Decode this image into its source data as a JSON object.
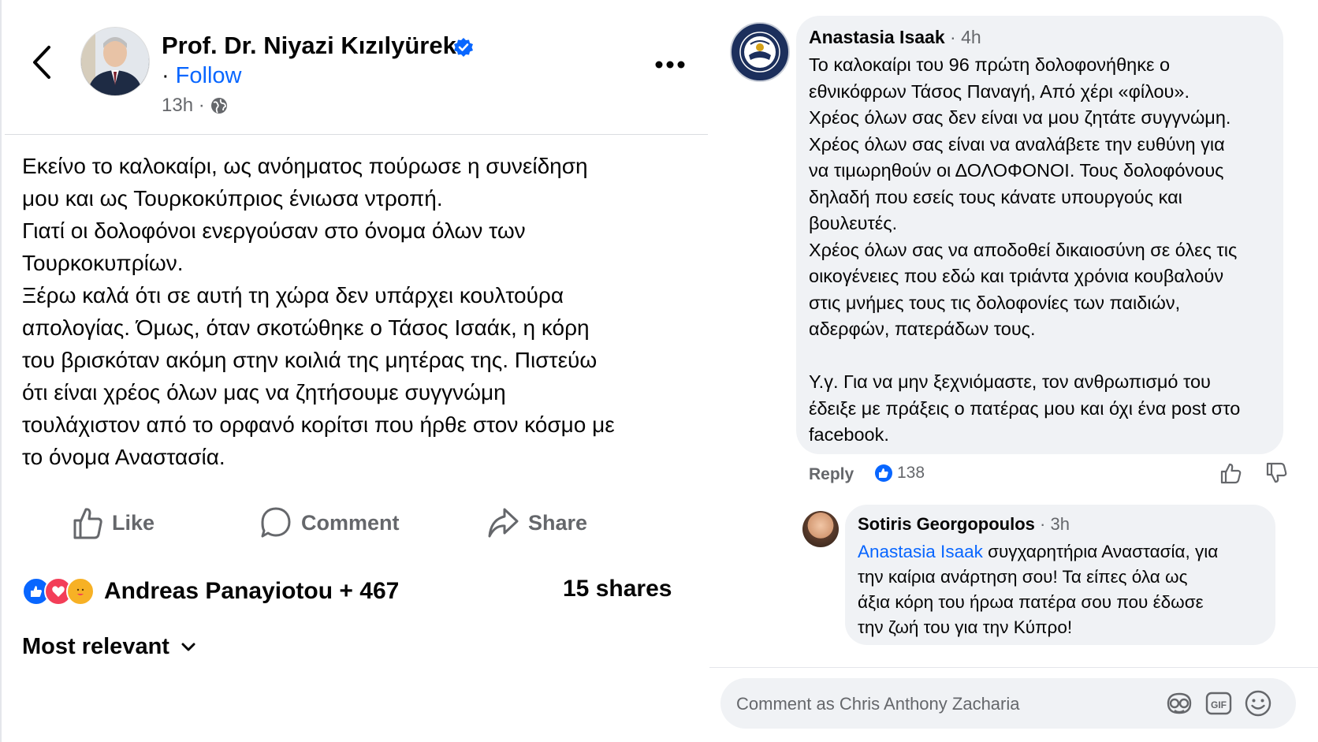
{
  "post": {
    "author": "Prof. Dr. Niyazi Kızılyürek",
    "follow_dot": "·",
    "follow_label": "Follow",
    "time": "13h ·",
    "body": [
      "Εκείνο το καλοκαίρι, ως ανόηματος πούρωσε η συνείδηση",
      "μου και ως Τουρκοκύπριος ένιωσα ντροπή.",
      "Γιατί οι δολοφόνοι ενεργούσαν στο όνομα όλων των",
      "Τουρκοκυπρίων.",
      "Ξέρω καλά ότι σε αυτή τη χώρα δεν υπάρχει κουλτούρα",
      "απολογίας. Όμως, όταν σκοτώθηκε ο Τάσος Ισαάκ, η κόρη",
      "του βρισκόταν ακόμη στην κοιλιά της μητέρας της. Πιστεύω",
      "ότι είναι χρέος όλων μας να ζητήσουμε συγγνώμη",
      "τουλάχιστον από το ορφανό κορίτσι που ήρθε στον κόσμο με",
      "το όνομα Αναστασία."
    ],
    "actions": {
      "like": "Like",
      "comment": "Comment",
      "share": "Share"
    },
    "reactions_text": "Andreas Panayiotou + 467",
    "shares_text": "15 shares",
    "sort_label": "Most relevant"
  },
  "comments": [
    {
      "author": "Anastasia Isaak",
      "time": "· 4h",
      "text": [
        "Το καλοκαίρι του 96 πρώτη δολοφονήθηκε ο",
        "εθνικόφρων Τάσος Παναγή, Από χέρι «φίλου».",
        "Χρέος όλων σας δεν είναι να μου ζητάτε συγγνώμη.",
        "Χρέος όλων σας είναι να αναλάβετε την ευθύνη για",
        "να τιμωρηθούν οι ΔΟΛΟΦΟΝΟΙ. Τους δολοφόνους",
        "δηλαδή που εσείς τους κάνατε υπουργούς και",
        "βουλευτές.",
        "Χρέος όλων σας να αποδοθεί δικαιοσύνη σε όλες τις",
        "οικογένειες που εδώ και τριάντα χρόνια κουβαλούν",
        "στις μνήμες τους τις δολοφονίες των παιδιών,",
        "αδερφών, πατεράδων τους.",
        "",
        "Υ.γ. Για να μην ξεχνιόμαστε, τον ανθρωπισμό του",
        "έδειξε με πράξεις ο πατέρας μου και όχι ένα post στο",
        "facebook."
      ],
      "reply_label": "Reply",
      "like_count": "138"
    },
    {
      "author": "Sotiris Georgopoulos",
      "time": "· 3h",
      "mention": "Anastasia Isaak",
      "text_first": " συγχαρητήρια Αναστασία, για",
      "text_rest": [
        "την καίρια ανάρτηση σου! Τα είπες όλα ως",
        "άξια κόρη του ήρωα πατέρα σου που έδωσε",
        "την ζωή του για την Κύπρο!"
      ]
    }
  ],
  "composer": {
    "placeholder": "Comment as Chris Anthony Zacharia"
  },
  "icons": {
    "back": "chevron-left-icon",
    "verified": "verified-badge-icon",
    "globe": "globe-icon",
    "more": "more-dots-icon",
    "like": "thumbs-up-icon",
    "comment": "comment-bubble-icon",
    "share": "share-arrow-icon",
    "dislike": "thumbs-down-icon",
    "sticker": "sticker-icon",
    "gif": "gif-icon",
    "emoji": "emoji-icon"
  },
  "colors": {
    "link_blue": "#0866ff",
    "bubble_bg": "#f0f2f5",
    "muted": "#65676b"
  }
}
